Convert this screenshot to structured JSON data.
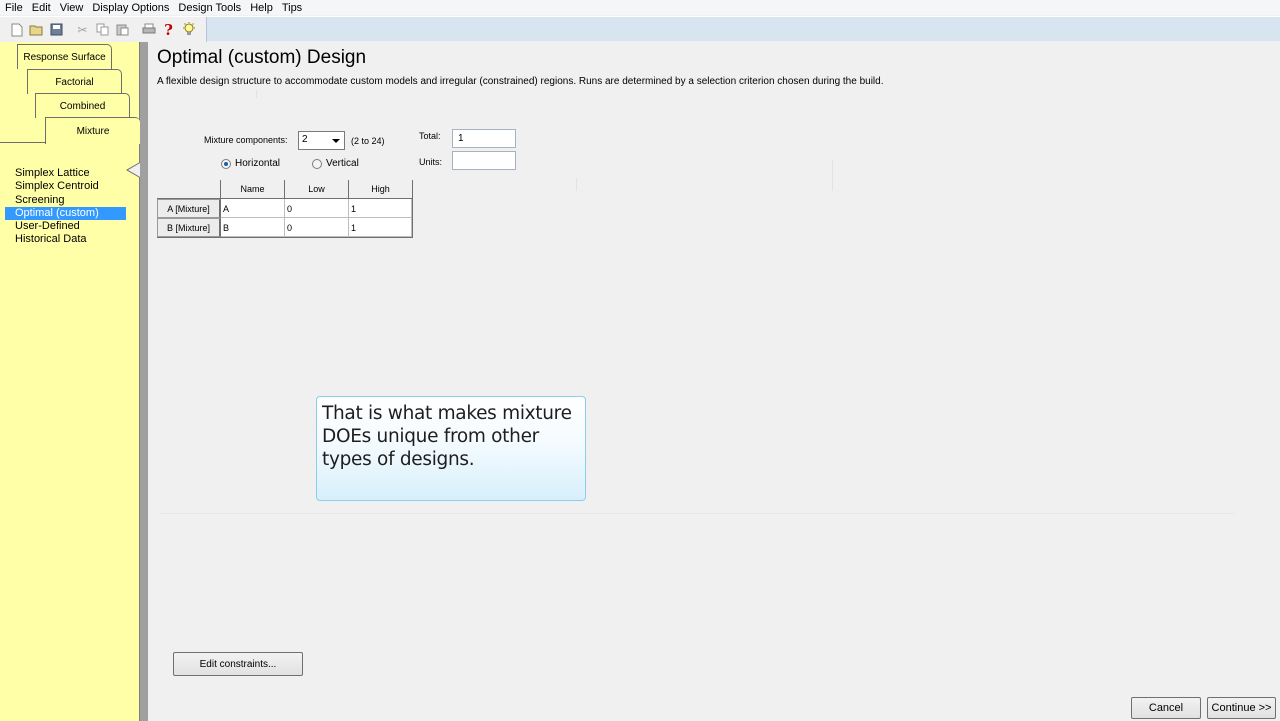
{
  "menu": [
    "File",
    "Edit",
    "View",
    "Display Options",
    "Design Tools",
    "Help",
    "Tips"
  ],
  "toolbar": {
    "icons": [
      "new-icon",
      "open-icon",
      "save-icon",
      "cut-icon",
      "copy-icon",
      "paste-icon",
      "print-icon",
      "help-icon",
      "tips-bulb-icon"
    ],
    "help_glyph": "?"
  },
  "tabs": {
    "response_surface": "Response Surface",
    "factorial": "Factorial",
    "combined": "Combined",
    "mixture": "Mixture"
  },
  "design_list": [
    "Simplex Lattice",
    "Simplex Centroid",
    "Screening",
    "Optimal (custom)",
    "User-Defined",
    "Historical Data"
  ],
  "selected_design": "Optimal (custom)",
  "main": {
    "title": "Optimal (custom) Design",
    "description": "A flexible design structure to accommodate custom models and irregular (constrained) regions.  Runs are determined by a selection criterion chosen during the build."
  },
  "mixture_settings": {
    "components_label": "Mixture components:",
    "components_value": "2",
    "components_range": "(2 to 24)",
    "total_label": "Total:",
    "total_value": "1",
    "units_label": "Units:",
    "units_value": "",
    "orientation_options": [
      "Horizontal",
      "Vertical"
    ],
    "orientation_selected": "Horizontal"
  },
  "components_table": {
    "columns": [
      "Name",
      "Low",
      "High"
    ],
    "rows": [
      {
        "header": "A [Mixture]",
        "name": "A",
        "low": "0",
        "high": "1"
      },
      {
        "header": "B [Mixture]",
        "name": "B",
        "low": "0",
        "high": "1"
      }
    ]
  },
  "callout": {
    "text": "That is what makes mixture DOEs unique from other types of designs."
  },
  "buttons": {
    "edit_constraints": "Edit constraints...",
    "cancel": "Cancel",
    "continue": "Continue >>"
  }
}
